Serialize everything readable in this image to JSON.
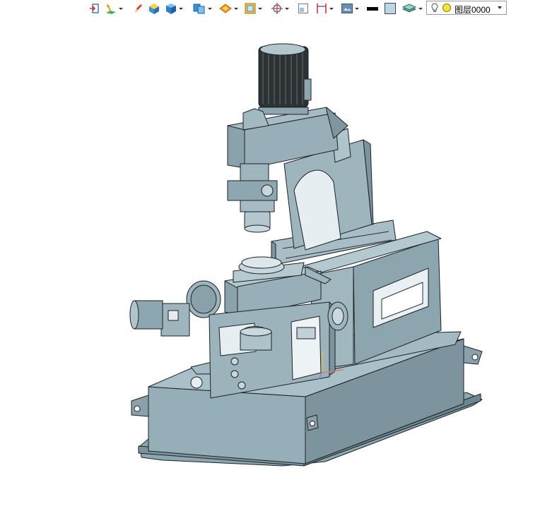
{
  "toolbar": {
    "layer_selector": {
      "value": "图层0000"
    },
    "line_color": "#000000",
    "fill_color": "#bcd8e6"
  },
  "viewport": {
    "model_color": "#93abb5",
    "edge_color": "#1a2226",
    "background": "#ffffff"
  }
}
